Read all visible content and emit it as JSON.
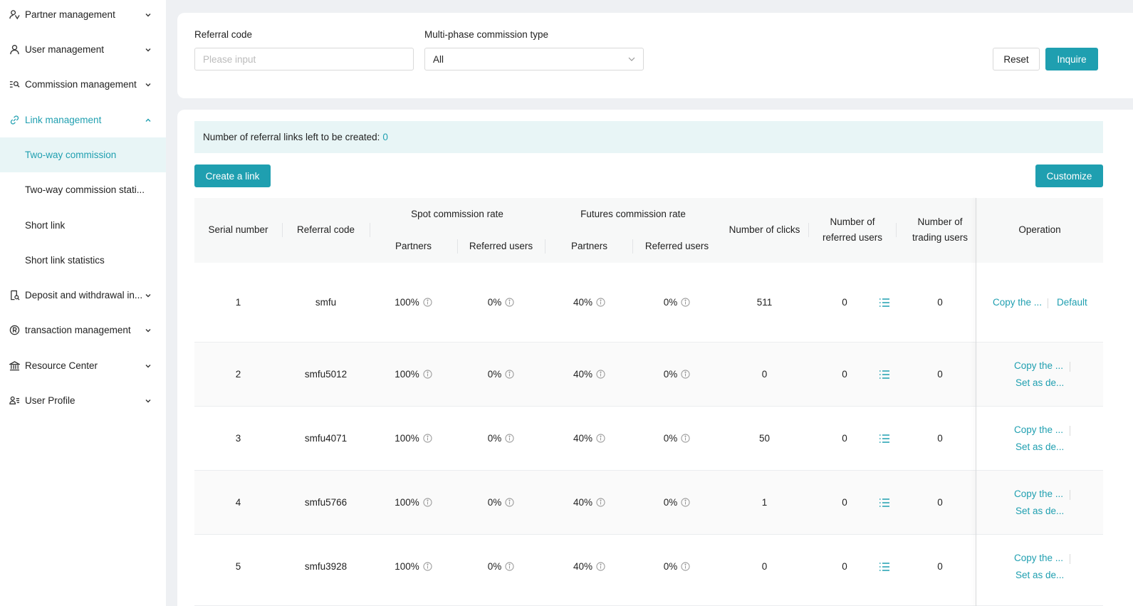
{
  "sidebar": {
    "items": [
      {
        "label": "Partner management",
        "icon": "partner-icon"
      },
      {
        "label": "User management",
        "icon": "user-icon"
      },
      {
        "label": "Commission management",
        "icon": "commission-icon"
      },
      {
        "label": "Link management",
        "icon": "link-icon"
      },
      {
        "label": "Deposit and withdrawal in...",
        "icon": "deposit-icon"
      },
      {
        "label": "transaction management",
        "icon": "transaction-icon"
      },
      {
        "label": "Resource Center",
        "icon": "bank-icon"
      },
      {
        "label": "User Profile",
        "icon": "profile-icon"
      }
    ],
    "subitems": [
      {
        "label": "Two-way commission"
      },
      {
        "label": "Two-way commission stati..."
      },
      {
        "label": "Short link"
      },
      {
        "label": "Short link statistics"
      }
    ]
  },
  "filter": {
    "referral_label": "Referral code",
    "referral_placeholder": "Please input",
    "type_label": "Multi-phase commission type",
    "type_value": "All",
    "reset_label": "Reset",
    "inquire_label": "Inquire"
  },
  "info": {
    "text": "Number of referral links left to be created:",
    "count": "0"
  },
  "toolbar": {
    "create_label": "Create a link",
    "customize_label": "Customize"
  },
  "table": {
    "headers": {
      "serial": "Serial number",
      "code": "Referral code",
      "spot": "Spot commission rate",
      "futures": "Futures commission rate",
      "partners": "Partners",
      "referred": "Referred users",
      "clicks": "Number of clicks",
      "num_referred": "Number of referred users",
      "num_trading": "Number of trading users",
      "operation": "Operation"
    },
    "rows": [
      {
        "serial": "1",
        "code": "smfu",
        "spot_partners": "100%",
        "spot_referred": "0%",
        "fut_partners": "40%",
        "fut_referred": "0%",
        "clicks": "511",
        "referred": "0",
        "trading": "0",
        "op1": "Copy the ...",
        "op2": "Default"
      },
      {
        "serial": "2",
        "code": "smfu5012",
        "spot_partners": "100%",
        "spot_referred": "0%",
        "fut_partners": "40%",
        "fut_referred": "0%",
        "clicks": "0",
        "referred": "0",
        "trading": "0",
        "op1": "Copy the ...",
        "op2": "Set as de..."
      },
      {
        "serial": "3",
        "code": "smfu4071",
        "spot_partners": "100%",
        "spot_referred": "0%",
        "fut_partners": "40%",
        "fut_referred": "0%",
        "clicks": "50",
        "referred": "0",
        "trading": "0",
        "op1": "Copy the ...",
        "op2": "Set as de..."
      },
      {
        "serial": "4",
        "code": "smfu5766",
        "spot_partners": "100%",
        "spot_referred": "0%",
        "fut_partners": "40%",
        "fut_referred": "0%",
        "clicks": "1",
        "referred": "0",
        "trading": "0",
        "op1": "Copy the ...",
        "op2": "Set as de..."
      },
      {
        "serial": "5",
        "code": "smfu3928",
        "spot_partners": "100%",
        "spot_referred": "0%",
        "fut_partners": "40%",
        "fut_referred": "0%",
        "clicks": "0",
        "referred": "0",
        "trading": "0",
        "op1": "Copy the ...",
        "op2": "Set as de..."
      }
    ]
  },
  "colors": {
    "accent": "#1f9fb0",
    "active_bg": "#e8f5f6"
  }
}
